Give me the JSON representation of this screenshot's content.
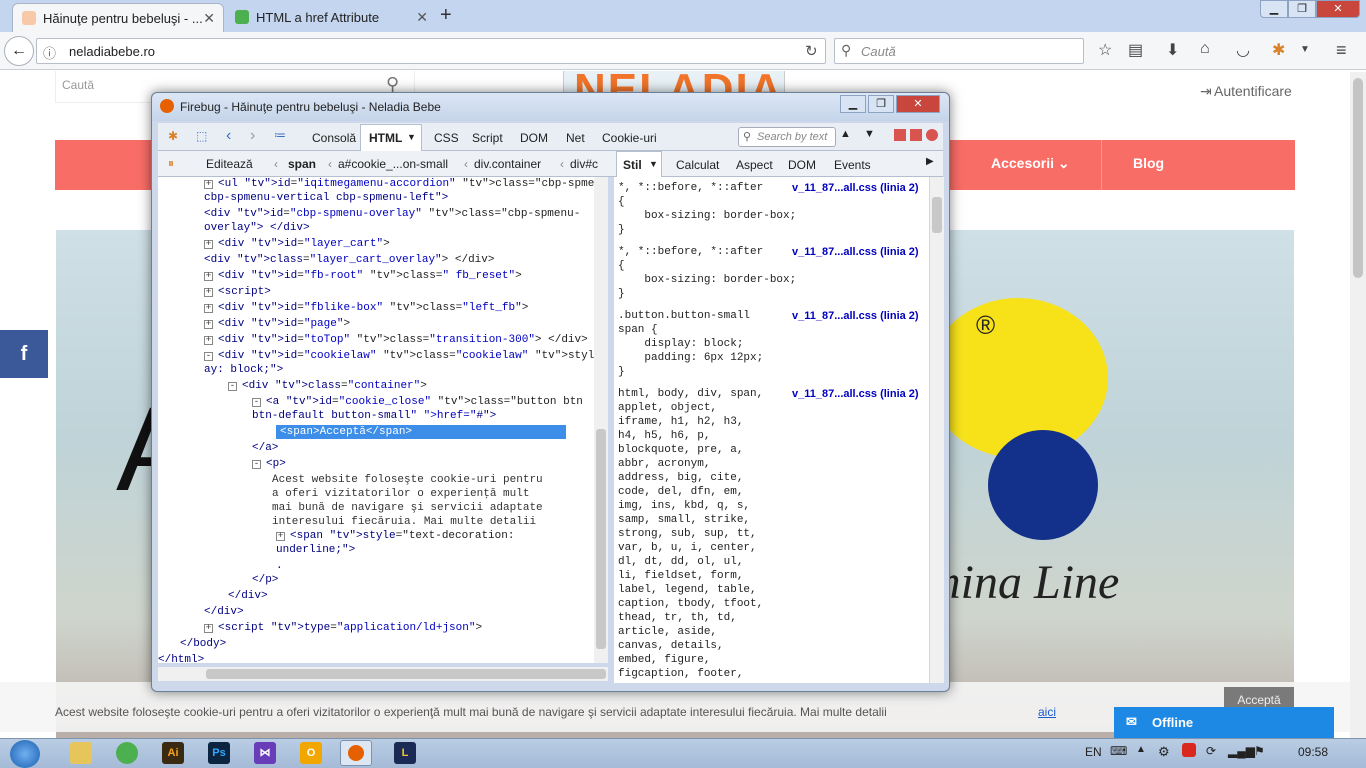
{
  "tabs": [
    {
      "title": "Hăinuţe pentru bebeluşi - ...",
      "active": true
    },
    {
      "title": "HTML a href Attribute",
      "active": false
    }
  ],
  "nav": {
    "url": "neladiabebe.ro",
    "search_placeholder": "Caută"
  },
  "site": {
    "search_placeholder": "Caută",
    "logo": "NELADIA",
    "login": "Autentificare",
    "menu_accessories": "Accesorii",
    "menu_blog": "Blog",
    "hero_text": "mina Line",
    "cookie_text": "Acest website foloseşte cookie-uri pentru a oferi vizitatorilor o experienţă mult mai bună de navigare şi servicii adaptate interesului fiecăruia. Mai multe detalii",
    "cookie_link": "aici",
    "cookie_button": "Acceptă",
    "offline_label": "Offline"
  },
  "firebug": {
    "title": "Firebug - Hăinuţe pentru bebeluşi - Neladia Bebe",
    "tabs": [
      "Consolă",
      "HTML",
      "CSS",
      "Script",
      "DOM",
      "Net",
      "Cookie-uri"
    ],
    "search_placeholder": "Search by text",
    "edit_label": "Editează",
    "breadcrumbs": [
      "span",
      "a#cookie_...on-small",
      "div.container",
      "div#c"
    ],
    "side_tabs": [
      "Stil",
      "Calculat",
      "Aspect",
      "DOM",
      "Events"
    ],
    "html_lines": [
      "<ul id=\"iqitmegamenu-accordion\" class=\"cbp-spmenu",
      "cbp-spmenu-vertical cbp-spmenu-left\">",
      "<div id=\"cbp-spmenu-overlay\" class=\"cbp-spmenu-",
      "overlay\"> </div>",
      "<div id=\"layer_cart\">",
      "<div class=\"layer_cart_overlay\"> </div>",
      "<div id=\"fb-root\" class=\" fb_reset\">",
      "<script>",
      "<div id=\"fblike-box\" class=\"left_fb\">",
      "<div id=\"page\">",
      "<div id=\"toTop\" class=\"transition-300\"> </div>",
      "<div id=\"cookielaw\" class=\"cookielaw\" style=\"displ",
      "ay: block;\">",
      "<div class=\"container\">",
      "<a id=\"cookie_close\" class=\"button btn",
      "btn-default button-small\" href=\"#\">",
      "<span>Acceptă</span>",
      "</a>",
      "<p>",
      "Acest website foloseşte cookie-uri pentru",
      "a oferi vizitatorilor o experienţă mult",
      "mai bună de navigare şi servicii adaptate",
      "interesului fiecăruia. Mai multe detalii",
      "<span style=\"text-decoration:",
      "underline;\">",
      ".",
      "</p>",
      "</div>",
      "</div>",
      "<script type=\"application/ld+json\">",
      "</body>",
      "</html>"
    ],
    "style_rules": [
      {
        "selector": "*, *::before, *::after",
        "file": "v_11_87...all.css (linia 2)",
        "body": [
          "{",
          "    box-sizing: border-box;",
          "}"
        ]
      },
      {
        "selector": "*, *::before, *::after",
        "file": "v_11_87...all.css (linia 2)",
        "body": [
          "{",
          "    box-sizing: border-box;",
          "}"
        ]
      },
      {
        "selector": ".button.button-small",
        "file": "v_11_87...all.css (linia 2)",
        "body": [
          "span {",
          "    display: block;",
          "    padding: 6px 12px;",
          "}"
        ]
      },
      {
        "selector": "html, body, div, span,",
        "file": "v_11_87...all.css (linia 2)",
        "body": [
          "applet, object,",
          "iframe, h1, h2, h3,",
          "h4, h5, h6, p,",
          "blockquote, pre, a,",
          "abbr, acronym,",
          "address, big, cite,",
          "code, del, dfn, em,",
          "img, ins, kbd, q, s,",
          "samp, small, strike,",
          "strong, sub, sup, tt,",
          "var, b, u, i, center,",
          "dl, dt, dd, ol, ul,",
          "li, fieldset, form,",
          "label, legend, table,",
          "caption, tbody, tfoot,",
          "thead, tr, th, td,",
          "article, aside,",
          "canvas, details,",
          "embed, figure,",
          "figcaption, footer,"
        ]
      }
    ]
  },
  "taskbar": {
    "language": "EN",
    "time": "09:58"
  }
}
